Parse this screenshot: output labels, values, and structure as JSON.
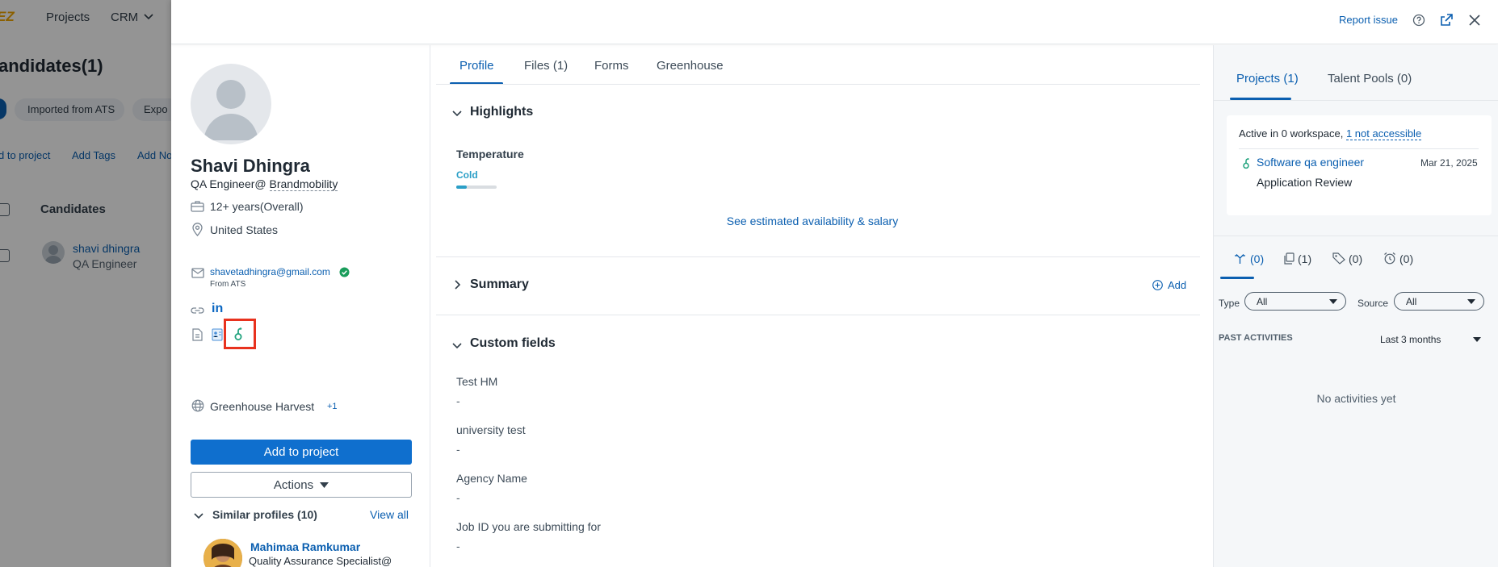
{
  "background": {
    "logo": "EZ",
    "nav": [
      "Projects",
      "CRM"
    ],
    "page_title": "andidates(1)",
    "filters": [
      "Imported from ATS",
      "Expo"
    ],
    "actions": [
      "d to project",
      "Add Tags",
      "Add No"
    ],
    "table_header": "Candidates",
    "row": {
      "name": "shavi dhingra",
      "title": "QA Engineer"
    }
  },
  "header": {
    "report_issue": "Report issue"
  },
  "profile": {
    "name": "Shavi Dhingra",
    "headline_prefix": "QA Engineer@ ",
    "headline_company": "Brandmobility",
    "experience": "12+ years(Overall)",
    "location": "United States",
    "email": "shavetadhingra@gmail.com",
    "email_source": "From ATS",
    "source": "Greenhouse Harvest",
    "source_more": "+1",
    "add_to_project": "Add to project",
    "actions": "Actions"
  },
  "similar": {
    "title": "Similar profiles (10)",
    "view_all": "View all",
    "first_name": "Mahimaa Ramkumar",
    "first_title": "Quality Assurance Specialist@"
  },
  "tabs": [
    {
      "label": "Profile"
    },
    {
      "label": "Files (1)"
    },
    {
      "label": "Forms"
    },
    {
      "label": "Greenhouse"
    }
  ],
  "highlights": {
    "title": "Highlights",
    "temperature_label": "Temperature",
    "temperature_value": "Cold",
    "temperature_level": 0.25,
    "estimate_link": "See estimated availability & salary"
  },
  "summary": {
    "title": "Summary",
    "add": "Add"
  },
  "custom_fields": {
    "title": "Custom fields",
    "fields": [
      {
        "label": "Test HM",
        "value": "-"
      },
      {
        "label": "university test",
        "value": "-"
      },
      {
        "label": "Agency Name",
        "value": "-"
      },
      {
        "label": "Job ID you are submitting for",
        "value": "-"
      }
    ]
  },
  "right": {
    "tabs": [
      "Projects (1)",
      "Talent Pools (0)"
    ],
    "workspace_text": "Active in 0 workspace, ",
    "workspace_link": "1 not accessible",
    "project_name": "Software qa engineer",
    "project_date": "Mar 21, 2025",
    "project_stage": "Application Review",
    "activity_counts": [
      "(0)",
      "(1)",
      "(0)",
      "(0)"
    ],
    "type_label": "Type",
    "type_value": "All",
    "source_label": "Source",
    "source_value": "All",
    "past_activities": "PAST ACTIVITIES",
    "range": "Last 3 months",
    "empty": "No activities yet"
  },
  "colors": {
    "accent": "#0b5fb0",
    "primary_button": "#0f6fce",
    "greenhouse": "#23a47f",
    "highlight_box": "#e8321e",
    "verified": "#1a9d5b"
  }
}
